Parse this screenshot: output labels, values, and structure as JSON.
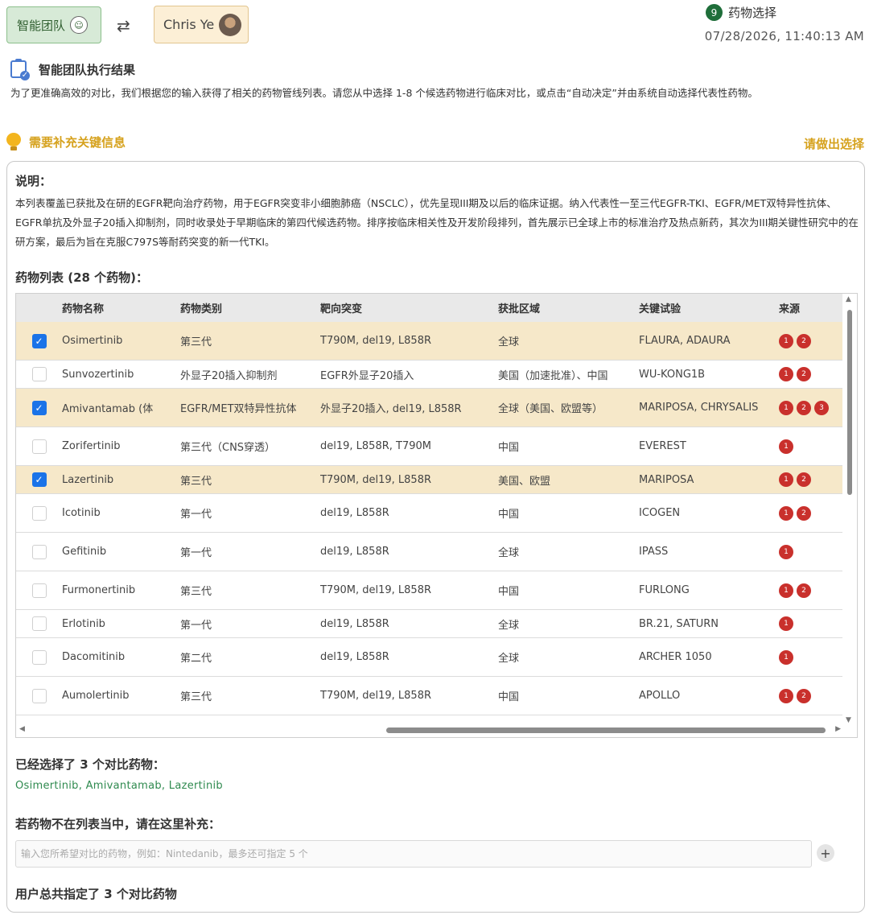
{
  "header": {
    "team_label": "智能团队",
    "user_name": "Chris Ye",
    "step_number": "9",
    "step_label": "药物选择",
    "timestamp": "07/28/2026, 11:40:13 AM"
  },
  "result": {
    "title": "智能团队执行结果",
    "intro": "为了更准确高效的对比，我们根据您的输入获得了相关的药物管线列表。请您从中选择 1-8 个候选药物进行临床对比，或点击“自动决定”并由系统自动选择代表性药物。"
  },
  "notice": {
    "text": "需要补充关键信息",
    "action": "请做出选择"
  },
  "panel": {
    "desc_label": "说明：",
    "desc_text": "本列表覆盖已获批及在研的EGFR靶向治疗药物，用于EGFR突变非小细胞肺癌（NSCLC），优先呈现III期及以后的临床证据。纳入代表性一至三代EGFR-TKI、EGFR/MET双特异性抗体、EGFR单抗及外显子20插入抑制剂，同时收录处于早期临床的第四代候选药物。排序按临床相关性及开发阶段排列，首先展示已全球上市的标准治疗及热点新药，其次为III期关键性研究中的在研方案，最后为旨在克服C797S等耐药突变的新一代TKI。",
    "list_label": "药物列表 (28 个药物)：",
    "columns": [
      "药物名称",
      "药物类别",
      "靶向突变",
      "获批区域",
      "关键试验",
      "来源"
    ],
    "rows": [
      {
        "name": "Osimertinib",
        "category": "第三代",
        "target": "T790M, del19, L858R",
        "region": "全球",
        "trial": "FLAURA, ADAURA",
        "sources": [
          "1",
          "2"
        ],
        "selected": true
      },
      {
        "name": "Sunvozertinib",
        "category": "外显子20插入抑制剂",
        "target": "EGFR外显子20插入",
        "region": "美国（加速批准）、中国",
        "trial": "WU-KONG1B",
        "sources": [
          "1",
          "2"
        ],
        "selected": false
      },
      {
        "name": "Amivantamab (体",
        "category": "EGFR/MET双特异性抗体",
        "target": "外显子20插入, del19, L858R",
        "region": "全球（美国、欧盟等）",
        "trial": "MARIPOSA, CHRYSALIS",
        "sources": [
          "1",
          "2",
          "3"
        ],
        "selected": true
      },
      {
        "name": "Zorifertinib",
        "category": "第三代（CNS穿透）",
        "target": "del19, L858R, T790M",
        "region": "中国",
        "trial": "EVEREST",
        "sources": [
          "1"
        ],
        "selected": false
      },
      {
        "name": "Lazertinib",
        "category": "第三代",
        "target": "T790M, del19, L858R",
        "region": "美国、欧盟",
        "trial": "MARIPOSA",
        "sources": [
          "1",
          "2"
        ],
        "selected": true
      },
      {
        "name": "Icotinib",
        "category": "第一代",
        "target": "del19, L858R",
        "region": "中国",
        "trial": "ICOGEN",
        "sources": [
          "1",
          "2"
        ],
        "selected": false
      },
      {
        "name": "Gefitinib",
        "category": "第一代",
        "target": "del19, L858R",
        "region": "全球",
        "trial": "IPASS",
        "sources": [
          "1"
        ],
        "selected": false
      },
      {
        "name": "Furmonertinib",
        "category": "第三代",
        "target": "T790M, del19, L858R",
        "region": "中国",
        "trial": "FURLONG",
        "sources": [
          "1",
          "2"
        ],
        "selected": false
      },
      {
        "name": "Erlotinib",
        "category": "第一代",
        "target": "del19, L858R",
        "region": "全球",
        "trial": "BR.21, SATURN",
        "sources": [
          "1"
        ],
        "selected": false
      },
      {
        "name": "Dacomitinib",
        "category": "第二代",
        "target": "del19, L858R",
        "region": "全球",
        "trial": "ARCHER 1050",
        "sources": [
          "1"
        ],
        "selected": false
      },
      {
        "name": "Aumolertinib",
        "category": "第三代",
        "target": "T790M, del19, L858R",
        "region": "中国",
        "trial": "APOLLO",
        "sources": [
          "1",
          "2"
        ],
        "selected": false
      }
    ],
    "chosen_label": "已经选择了 3 个对比药物：",
    "chosen_list": "Osimertinib, Amivantamab, Lazertinib",
    "add_label": "若药物不在列表当中，请在这里补充：",
    "add_placeholder": "输入您所希望对比的药物，例如：Nintedanib，最多还可指定 5 个",
    "add_value": "",
    "summary": "用户总共指定了 3 个对比药物"
  },
  "colors": {
    "selected_row": "#f6e8c9",
    "accent_gold": "#d6a21e",
    "source_badge": "#c9302c",
    "checkbox_on": "#1a73e8",
    "chosen_text": "#2f8a4f"
  },
  "icons": {
    "team": "team-avatar-icon",
    "swap": "swap-arrows-icon",
    "clipboard": "clipboard-check-icon",
    "bulb": "lightbulb-icon",
    "plus": "plus-icon"
  }
}
